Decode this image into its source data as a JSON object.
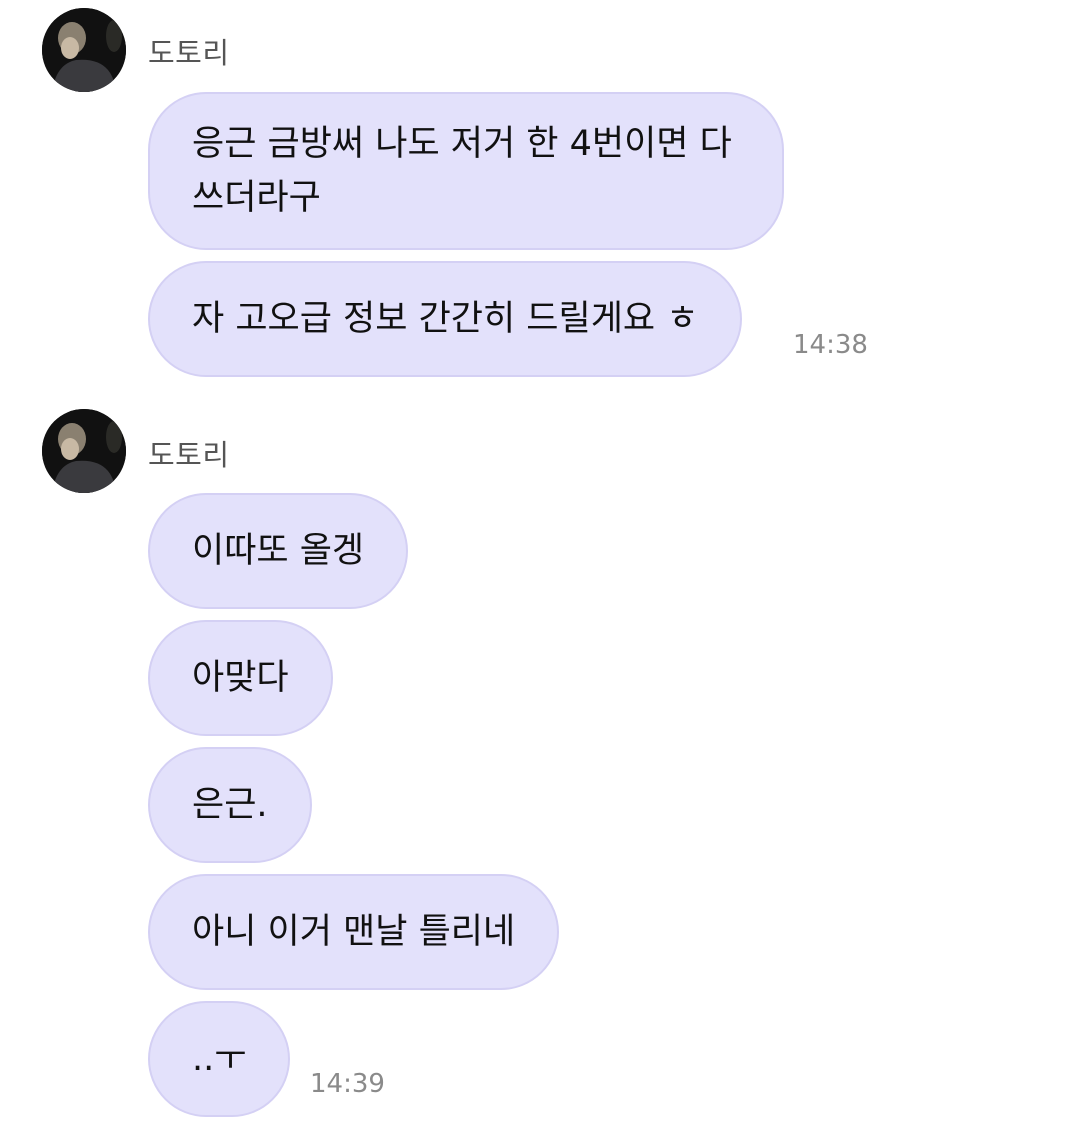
{
  "groups": [
    {
      "sender": "도토리",
      "messages": [
        "응근 금방써 나도 저거 한 4번이면 다쓰더라구",
        "자 고오급 정보 간간히 드릴게요 ㅎ"
      ],
      "time": "14:38"
    },
    {
      "sender": "도토리",
      "messages": [
        "이따또 올겡",
        "아맞다",
        "은근.",
        "아니 이거 맨날 틀리네",
        "..ㅜ"
      ],
      "time": "14:39"
    }
  ],
  "colors": {
    "bubble": "#e3e1fb",
    "bubble_border": "#d4d0f4",
    "text": "#111111",
    "sender": "#555555",
    "time": "#8a8a8a"
  }
}
